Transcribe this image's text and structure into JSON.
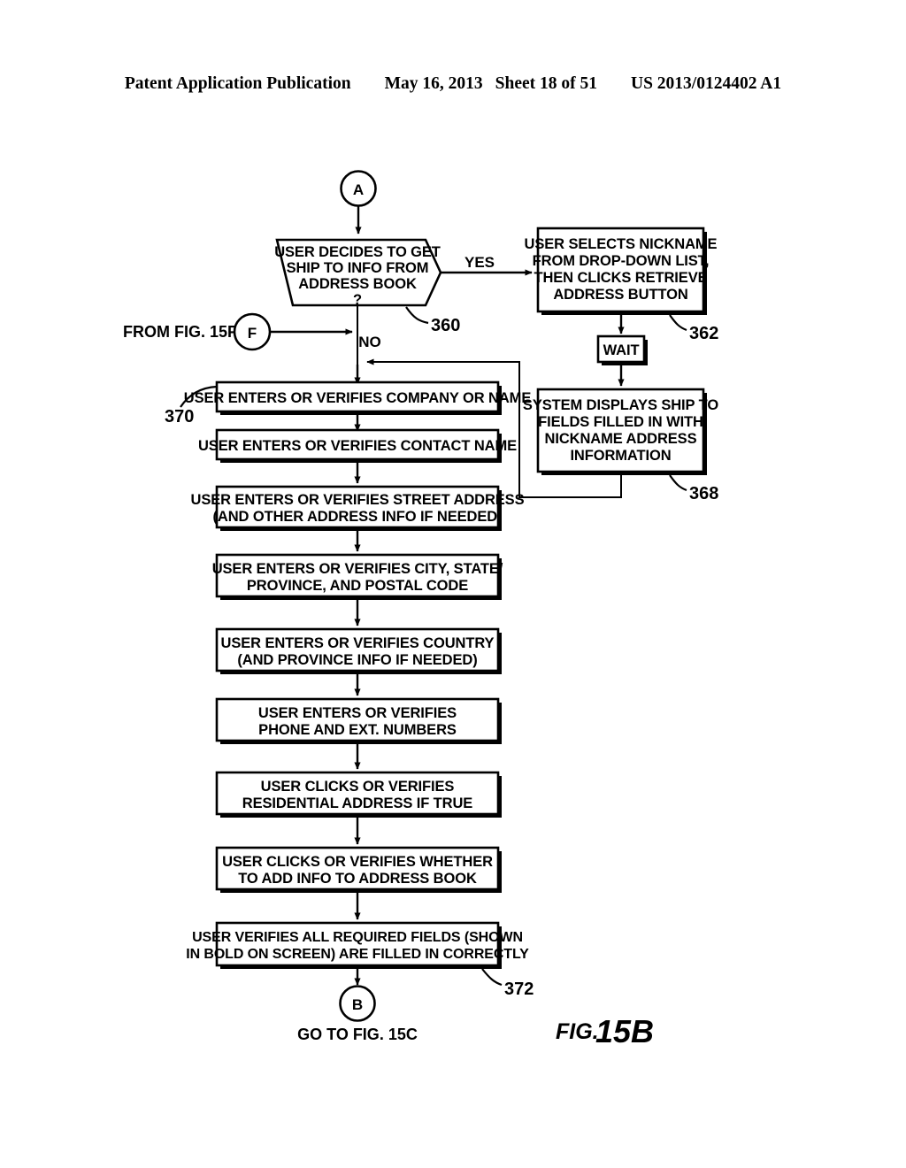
{
  "header": {
    "publication": "Patent Application Publication",
    "date": "May 16, 2013",
    "sheet": "Sheet 18 of 51",
    "patent_number": "US 2013/0124402 A1"
  },
  "figure": {
    "caption_prefix": "FIG.",
    "caption_number": "15B"
  },
  "connectors": {
    "entry_a": "A",
    "entry_f": "F",
    "entry_f_label": "FROM FIG. 15F",
    "exit_b": "B",
    "exit_b_label": "GO TO FIG. 15C"
  },
  "edge_labels": {
    "yes": "YES",
    "no": "NO"
  },
  "decision": {
    "line1": "USER DECIDES TO GET",
    "line2": "SHIP TO INFO FROM",
    "line3": "ADDRESS BOOK",
    "line4": "?",
    "ref": "360"
  },
  "right_branch": {
    "select_nickname": {
      "line1": "USER SELECTS NICKNAME",
      "line2": "FROM DROP-DOWN LIST,",
      "line3": "THEN CLICKS RETRIEVE",
      "line4": "ADDRESS BUTTON",
      "ref": "362"
    },
    "wait": {
      "label": "WAIT"
    },
    "system_displays": {
      "line1": "SYSTEM DISPLAYS SHIP TO",
      "line2": "FIELDS FILLED IN WITH",
      "line3": "NICKNAME ADDRESS",
      "line4": "INFORMATION",
      "ref": "368"
    }
  },
  "main_chain": {
    "ref_top": "370",
    "ref_bottom": "372",
    "steps": [
      {
        "line1": "USER ENTERS OR VERIFIES COMPANY OR NAME",
        "line2": ""
      },
      {
        "line1": "USER ENTERS OR VERIFIES CONTACT NAME",
        "line2": ""
      },
      {
        "line1": "USER ENTERS OR VERIFIES STREET ADDRESS",
        "line2": "(AND OTHER ADDRESS INFO IF NEEDED)"
      },
      {
        "line1": "USER ENTERS OR VERIFIES CITY, STATE/",
        "line2": "PROVINCE, AND POSTAL CODE"
      },
      {
        "line1": "USER ENTERS OR VERIFIES COUNTRY",
        "line2": "(AND PROVINCE INFO IF NEEDED)"
      },
      {
        "line1": "USER ENTERS OR VERIFIES",
        "line2": "PHONE AND EXT. NUMBERS"
      },
      {
        "line1": "USER CLICKS OR VERIFIES",
        "line2": "RESIDENTIAL ADDRESS IF TRUE"
      },
      {
        "line1": "USER CLICKS OR VERIFIES WHETHER",
        "line2": "TO ADD INFO TO ADDRESS BOOK"
      },
      {
        "line1": "USER VERIFIES ALL REQUIRED FIELDS (SHOWN",
        "line2": "IN BOLD ON SCREEN) ARE FILLED IN CORRECTLY"
      }
    ]
  }
}
